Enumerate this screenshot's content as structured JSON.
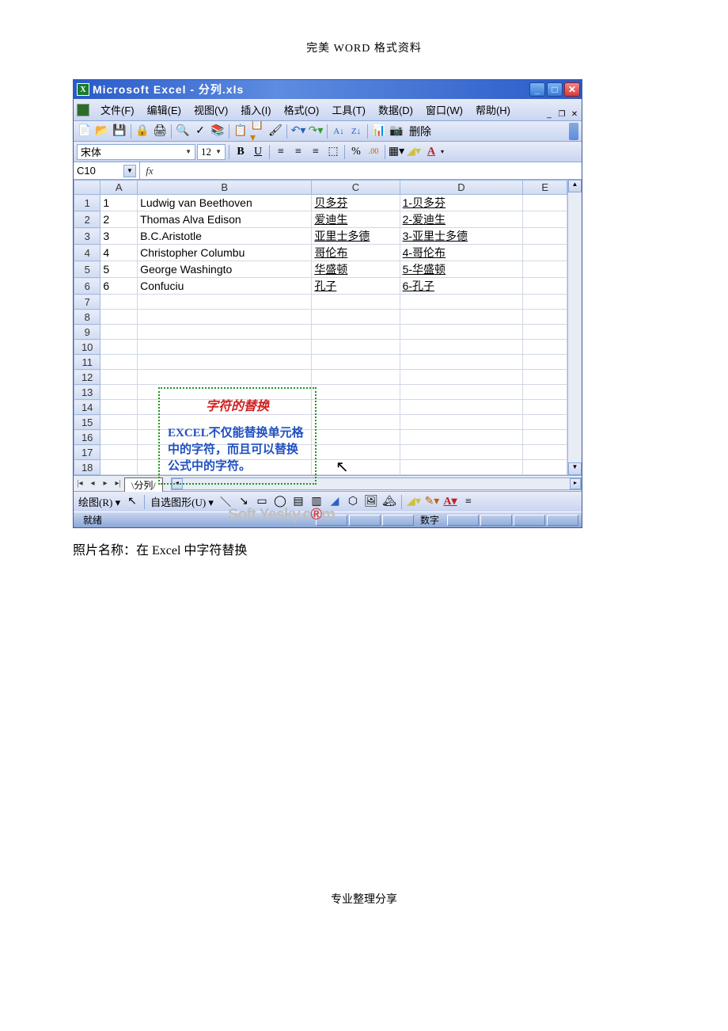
{
  "doc_header": "完美 WORD 格式资料",
  "window_title": "Microsoft Excel - 分列.xls",
  "menu": {
    "file": "文件(F)",
    "edit": "编辑(E)",
    "view": "视图(V)",
    "insert": "插入(I)",
    "format": "格式(O)",
    "tools": "工具(T)",
    "data": "数据(D)",
    "window": "窗口(W)",
    "help": "帮助(H)"
  },
  "toolbar_delete": "删除",
  "format": {
    "font_name": "宋体",
    "font_size": "12",
    "bold": "B",
    "underline": "U",
    "percent": "%",
    "decimal": ".00",
    "fontcolor": "A"
  },
  "namebox": "C10",
  "fx_label": "fx",
  "fx_value": "",
  "col_headers": [
    "A",
    "B",
    "C",
    "D",
    "E"
  ],
  "rows": [
    {
      "n": "1",
      "a": "1",
      "b": "Ludwig van Beethoven",
      "c": "贝多芬",
      "d": "1-贝多芬"
    },
    {
      "n": "2",
      "a": "2",
      "b": "Thomas Alva Edison",
      "c": "爱迪生",
      "d": "2-爱迪生"
    },
    {
      "n": "3",
      "a": "3",
      "b": "B.C.Aristotle",
      "c": "亚里士多德",
      "d": "3-亚里士多德"
    },
    {
      "n": "4",
      "a": "4",
      "b": "Christopher Columbu",
      "c": "哥伦布",
      "d": "4-哥伦布"
    },
    {
      "n": "5",
      "a": "5",
      "b": "George Washingto",
      "c": "华盛顿",
      "d": "5-华盛顿"
    },
    {
      "n": "6",
      "a": "6",
      "b": "Confuciu",
      "c": "孔子",
      "d": "6-孔子"
    },
    {
      "n": "7",
      "a": "",
      "b": "",
      "c": "",
      "d": ""
    },
    {
      "n": "8",
      "a": "",
      "b": "",
      "c": "",
      "d": ""
    },
    {
      "n": "9",
      "a": "",
      "b": "",
      "c": "",
      "d": ""
    },
    {
      "n": "10",
      "a": "",
      "b": "",
      "c": "",
      "d": ""
    },
    {
      "n": "11",
      "a": "",
      "b": "",
      "c": "",
      "d": ""
    },
    {
      "n": "12",
      "a": "",
      "b": "",
      "c": "",
      "d": ""
    },
    {
      "n": "13",
      "a": "",
      "b": "",
      "c": "",
      "d": ""
    },
    {
      "n": "14",
      "a": "",
      "b": "",
      "c": "",
      "d": ""
    },
    {
      "n": "15",
      "a": "",
      "b": "",
      "c": "",
      "d": ""
    },
    {
      "n": "16",
      "a": "",
      "b": "",
      "c": "",
      "d": ""
    },
    {
      "n": "17",
      "a": "",
      "b": "",
      "c": "",
      "d": ""
    },
    {
      "n": "18",
      "a": "",
      "b": "",
      "c": "",
      "d": ""
    }
  ],
  "callout": {
    "title": "字符的替换",
    "body": "EXCEL不仅能替换单元格中的字符，而且可以替换公式中的字符。"
  },
  "watermark": "Soft.Yesky.c",
  "watermark_red": "®",
  "watermark_tail": "m",
  "sheet_tab": "分列",
  "draw": {
    "label": "绘图(R)",
    "autoshape": "自选图形(U)"
  },
  "status": {
    "ready": "就绪",
    "numlock": "数字"
  },
  "caption": "照片名称：在 Excel 中字符替换",
  "footer": "专业整理分享"
}
